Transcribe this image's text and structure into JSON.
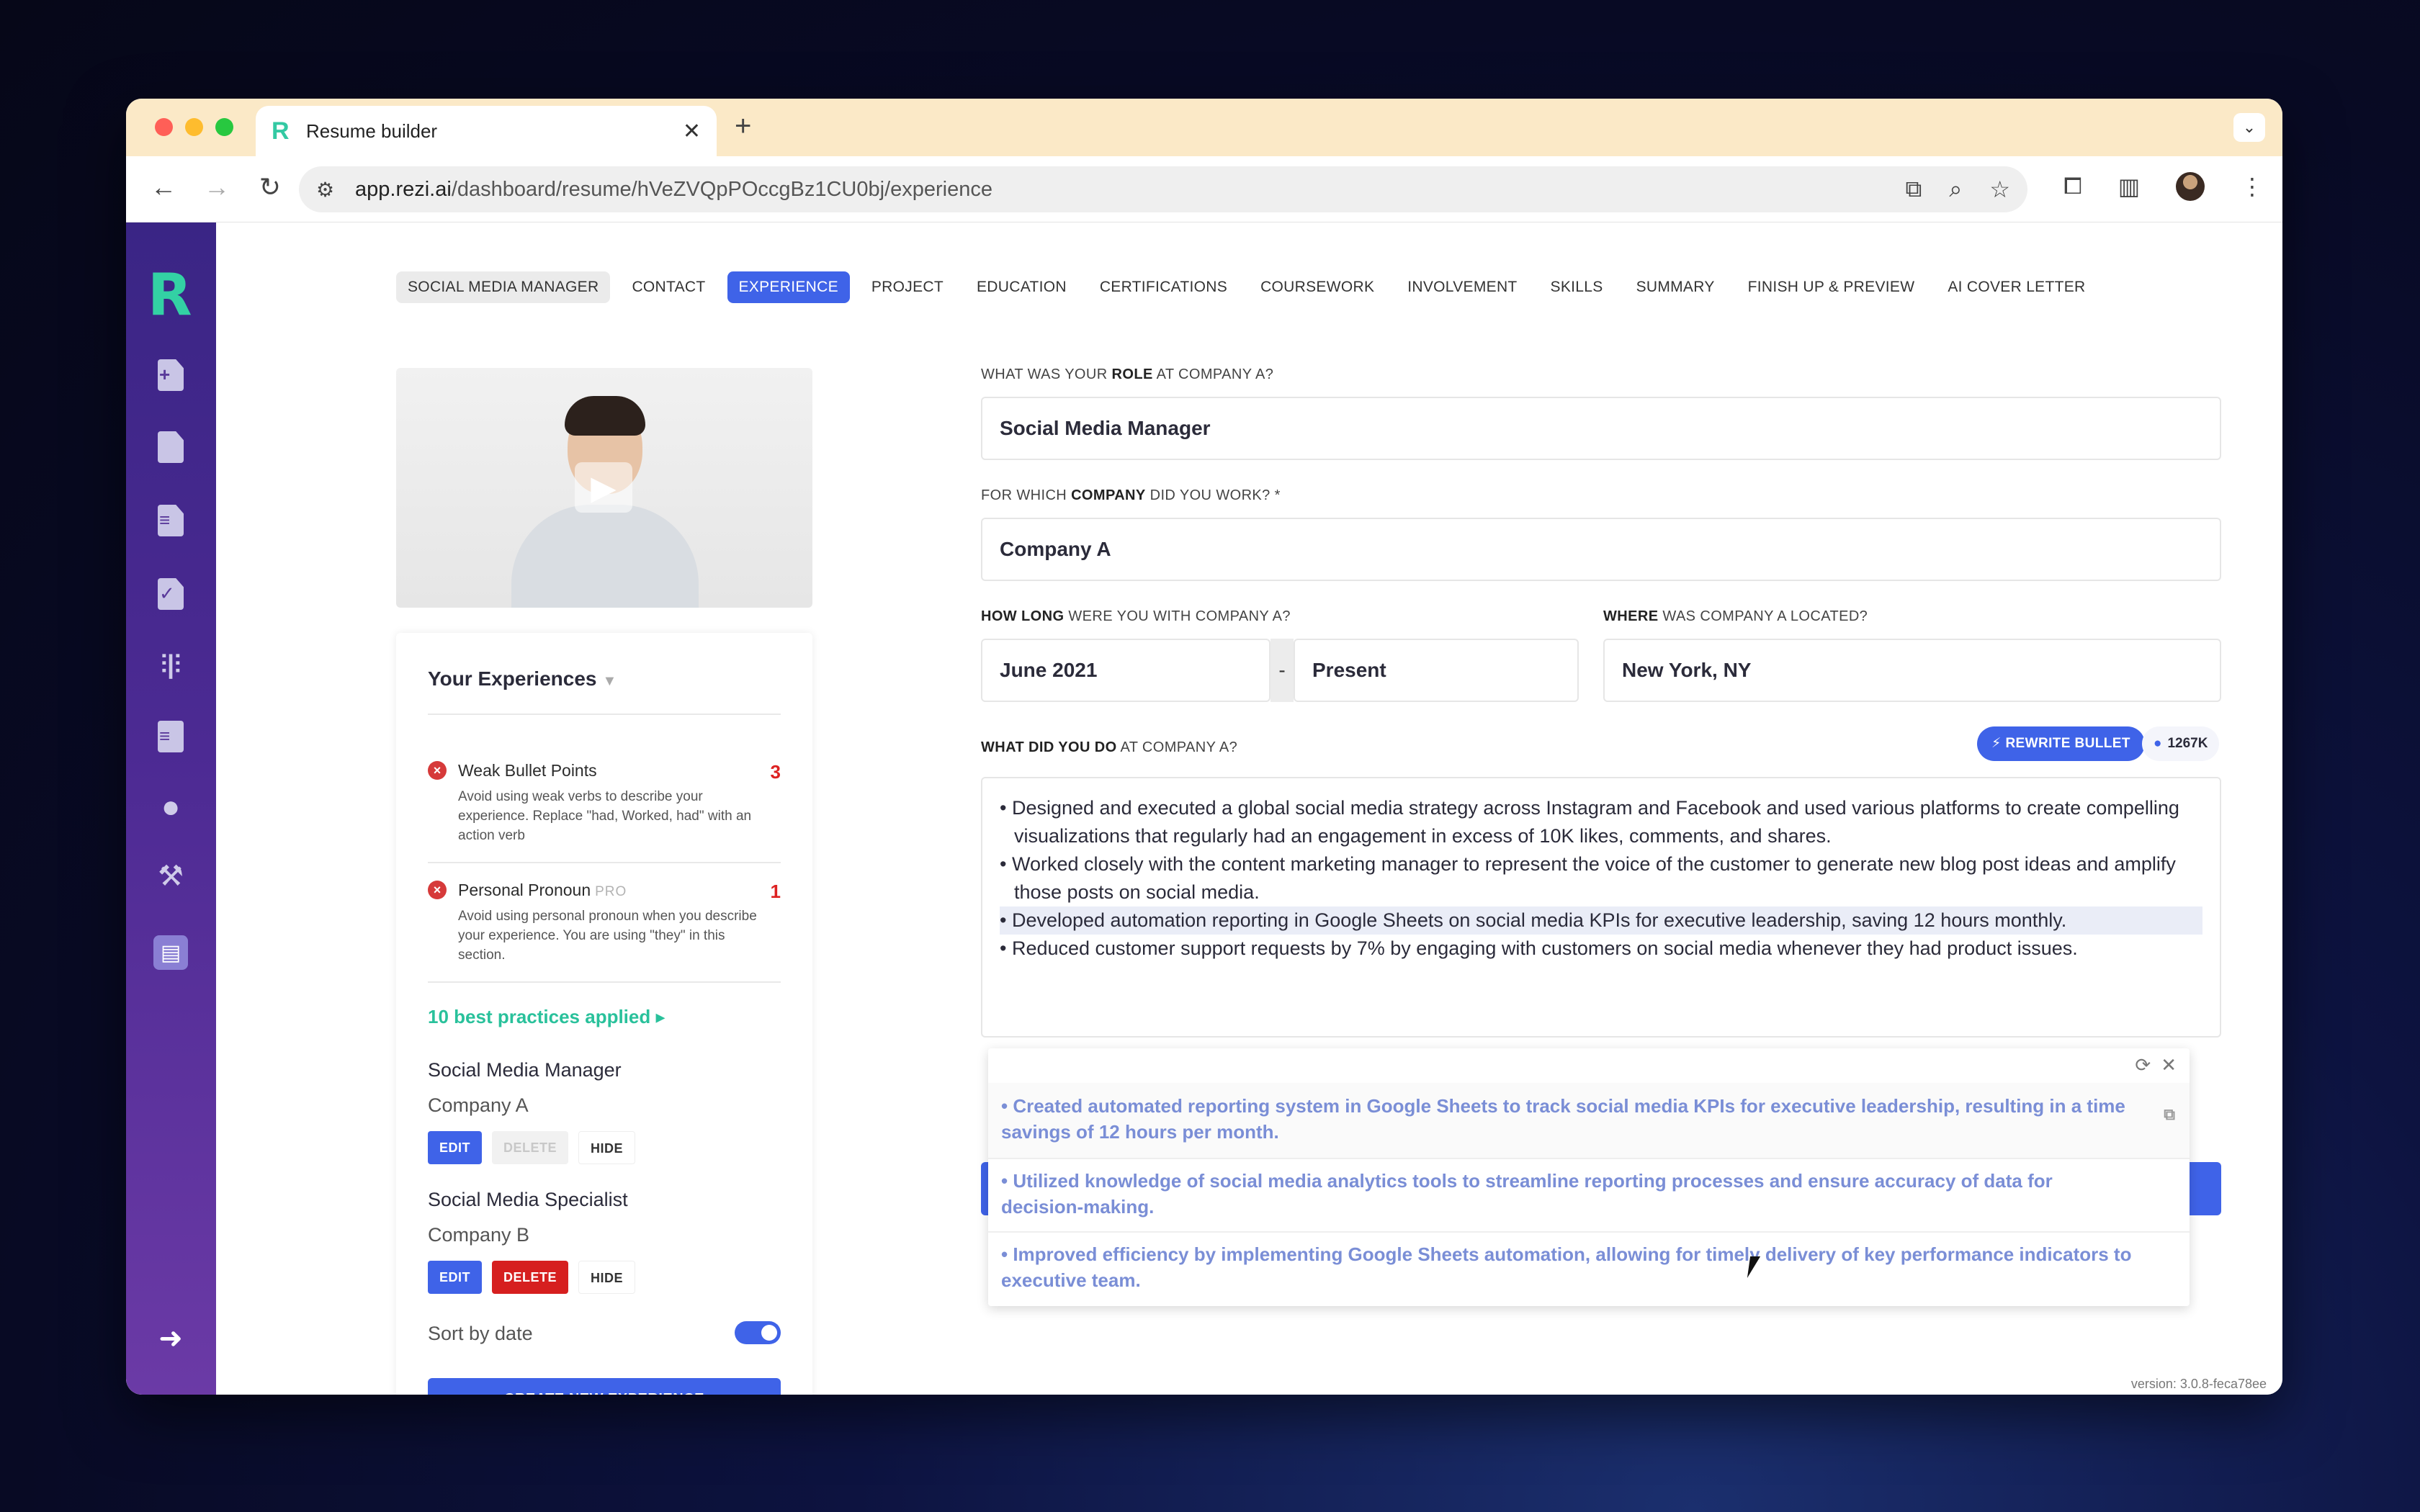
{
  "browser": {
    "tab_title": "Resume builder",
    "new_tab_glyph": "+",
    "close_glyph": "✕",
    "url_host": "app.rezi.ai",
    "url_path": "/dashboard/resume/hVeZVQpPOccgBz1CU0bj/experience",
    "colors": {
      "close": "#ff5f57",
      "minimize": "#febc2e",
      "maximize": "#28c840"
    }
  },
  "sidebar": {
    "logo": "R",
    "icons": [
      "new-resume-icon",
      "document-icon",
      "document-lines-icon",
      "document-check-icon",
      "audio-wave-icon",
      "list-doc-icon",
      "chat-icon",
      "hammer-icon",
      "stack-icon",
      "logout-icon"
    ]
  },
  "steps": [
    {
      "label": "Social Media Manager"
    },
    {
      "label": "Contact"
    },
    {
      "label": "Experience"
    },
    {
      "label": "Project"
    },
    {
      "label": "Education"
    },
    {
      "label": "Certifications"
    },
    {
      "label": "Coursework"
    },
    {
      "label": "Involvement"
    },
    {
      "label": "Skills"
    },
    {
      "label": "Summary"
    },
    {
      "label": "Finish Up & Preview"
    },
    {
      "label": "AI Cover Letter"
    }
  ],
  "experiences_panel": {
    "title": "Your Experiences",
    "issues": [
      {
        "title": "Weak Bullet Points",
        "count": "3",
        "desc": "Avoid using weak verbs to describe your experience. Replace \"had, Worked, had\" with an action verb"
      },
      {
        "title": "Personal Pronoun",
        "badge": "PRO",
        "count": "1",
        "desc": "Avoid using personal pronoun when you describe your experience. You are using \"they\" in this section."
      }
    ],
    "best_practices": "10 best practices applied",
    "entries": [
      {
        "role": "Social Media Manager",
        "company": "Company A"
      },
      {
        "role": "Social Media Specialist",
        "company": "Company B"
      }
    ],
    "buttons": {
      "edit": "EDIT",
      "delete": "DELETE",
      "hide": "HIDE"
    },
    "sort_label": "Sort by date",
    "create_label": "CREATE NEW EXPERIENCE"
  },
  "form": {
    "role_label_pre": "What was your ",
    "role_label_bold": "role",
    "role_label_post": " at Company A?",
    "role_value": "Social Media Manager",
    "company_label_pre": "For which ",
    "company_label_bold": "company",
    "company_label_post": " did you work?  *",
    "company_value": "Company A",
    "duration_label_bold": "How long",
    "duration_label_post": " were you with Company A?",
    "start_value": "June 2021",
    "dash": "-",
    "end_value": "Present",
    "location_label_bold": "Where",
    "location_label_post": " was Company A located?",
    "location_value": "New York, NY",
    "did_label_bold": "What did you do",
    "did_label_post": " at Company A?",
    "rewrite_label": "REWRITE BULLET",
    "tokens": "1267K",
    "bullets": [
      "• Designed and executed a global social media strategy across Instagram and Facebook and used various platforms to create compelling visualizations that regularly had an engagement in excess of 10K likes, comments, and shares.",
      "• Worked closely with the content marketing manager to represent the voice of the customer to generate new blog post ideas and amplify those posts on social media.",
      "• Developed automation reporting in Google Sheets on social media KPIs for executive leadership, saving 12 hours monthly.",
      "• Reduced customer support requests by 7% by engaging with customers on social media whenever they had product issues."
    ]
  },
  "suggestions": [
    "• Created automated reporting system in Google Sheets to track social media KPIs for executive leadership, resulting in a time savings of 12 hours per month.",
    "• Utilized knowledge of social media analytics tools to streamline reporting processes and ensure accuracy of data for decision-making.",
    "• Improved efficiency by implementing Google Sheets automation, allowing for timely delivery of key performance indicators to executive team."
  ],
  "version": "version: 3.0.8-feca78ee"
}
